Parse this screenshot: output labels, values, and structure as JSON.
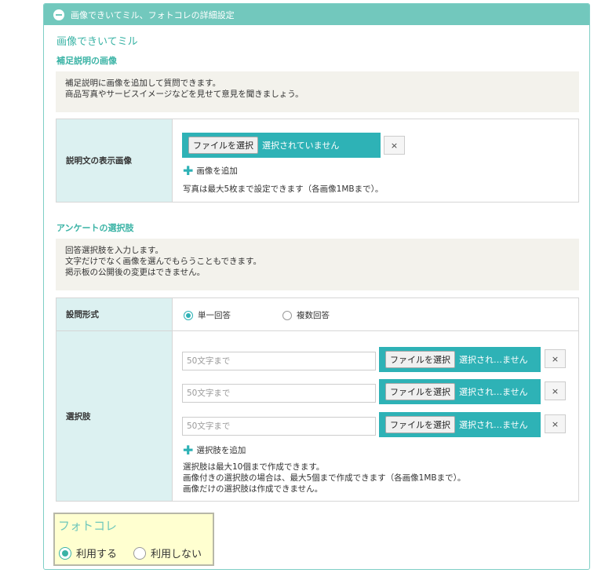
{
  "header": {
    "title": "画像できいてミル、フォトコレの詳細設定"
  },
  "section_title": "画像できいてミル",
  "supplement": {
    "subtitle": "補足説明の画像",
    "info_line1": "補足説明に画像を追加して質問できます。",
    "info_line2": "商品写真やサービスイメージなどを見せて意見を聞きましょう。",
    "row_label": "説明文の表示画像",
    "file_button": "ファイルを選択",
    "file_status": "選択されていません",
    "remove": "×",
    "add_label": "画像を追加",
    "note": "写真は最大5枚まで設定できます（各画像1MBまで）。"
  },
  "survey": {
    "subtitle": "アンケートの選択肢",
    "info_line1": "回答選択肢を入力します。",
    "info_line2": "文字だけでなく画像を選んでもらうこともできます。",
    "info_line3": "掲示板の公開後の変更はできません。",
    "question_type_label": "設問形式",
    "single": "単一回答",
    "multiple": "複数回答",
    "single_selected": true,
    "choices_label": "選択肢",
    "choices": [
      {
        "placeholder": "50文字まで",
        "file_button": "ファイルを選択",
        "file_status": "選択され…ません",
        "remove": "×"
      },
      {
        "placeholder": "50文字まで",
        "file_button": "ファイルを選択",
        "file_status": "選択され…ません",
        "remove": "×"
      },
      {
        "placeholder": "50文字まで",
        "file_button": "ファイルを選択",
        "file_status": "選択され…ません",
        "remove": "×"
      }
    ],
    "add_label": "選択肢を追加",
    "note1": "選択肢は最大10個まで作成できます。",
    "note2": "画像付きの選択肢の場合は、最大5個まで作成できます（各画像1MBまで）。",
    "note3": "画像だけの選択肢は作成できません。"
  },
  "photocolle": {
    "title": "フォトコレ",
    "use": "利用する",
    "not_use": "利用しない",
    "use_selected": true
  },
  "colors": {
    "accent": "#2eb2b6",
    "header": "#72c8bd",
    "label_bg": "#dcf1f1",
    "info_bg": "#f3f2ec",
    "highlight": "#ffffd0"
  }
}
